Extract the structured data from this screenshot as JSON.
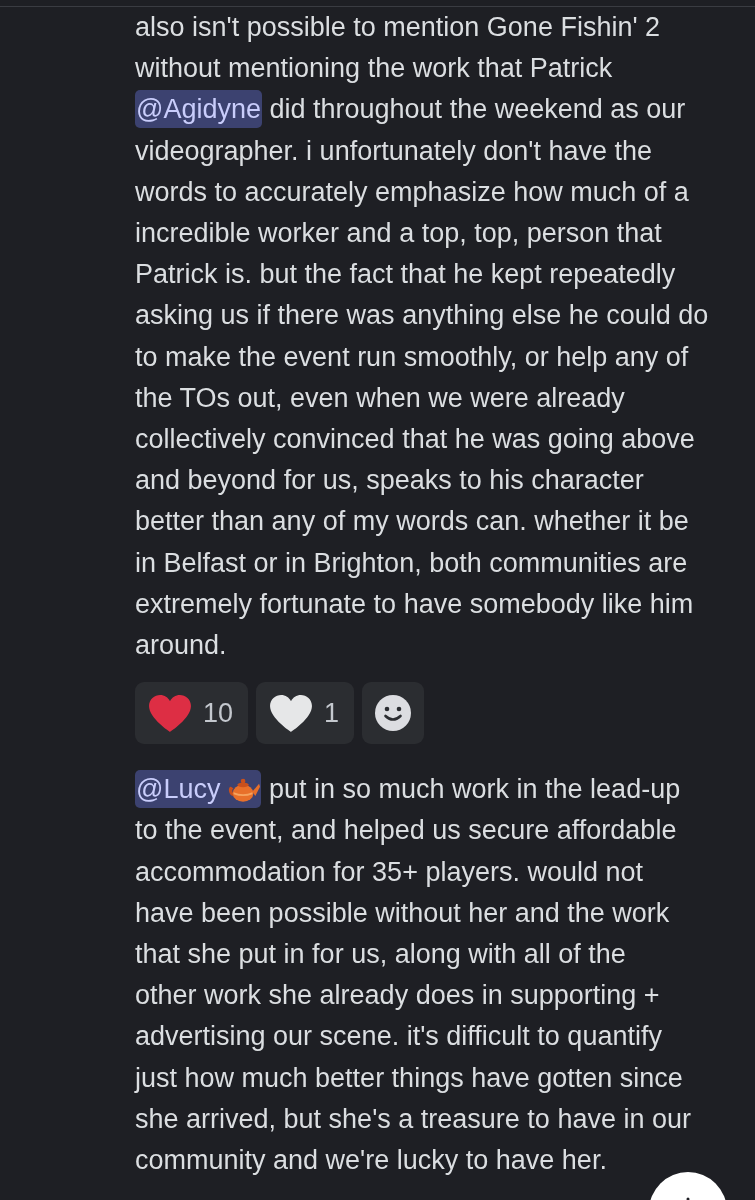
{
  "messages": [
    {
      "content": [
        {
          "kind": "text",
          "text": "also isn't possible to mention Gone Fishin' 2\nwithout mentioning the work that Patrick\n"
        },
        {
          "kind": "mention",
          "text": "@Agidyne"
        },
        {
          "kind": "text",
          "text": " did throughout the weekend as our\nvideographer. i unfortunately don't have the\nwords to accurately emphasize how much of a\nincredible worker and a top, top, person that\nPatrick is. but the fact that he kept repeatedly\nasking us if there was anything else he could do\nto make the event run smoothly, or help any of\nthe TOs out, even when we were already\ncollectively convinced that he was going above\nand beyond for us, speaks to his character\nbetter than any of my words can. whether it be\nin Belfast or in Brighton, both communities are\nextremely fortunate to have somebody like him\naround."
        }
      ],
      "reactions": [
        {
          "kind": "emoji",
          "color": "#dd2e44",
          "count": "10",
          "selected": false
        },
        {
          "kind": "emoji",
          "color": "#e6e7e8",
          "count": "1",
          "selected": false
        },
        {
          "kind": "add"
        }
      ]
    },
    {
      "content": [
        {
          "kind": "mention",
          "text": "@Lucy",
          "icon": true
        },
        {
          "kind": "text",
          "text": " put in so much work in the lead-up\nto the event, and helped us secure affordable\naccommodation for 35+ players. would not\nhave been possible without her and the work\nthat she put in for us, along with all of the\nother work she already does in supporting +\nadvertising our scene. it's difficult to quantify\njust how much better things have gotten since\nshe arrived, but she's a treasure to have in our\ncommunity and we're lucky to have her."
        }
      ]
    }
  ]
}
